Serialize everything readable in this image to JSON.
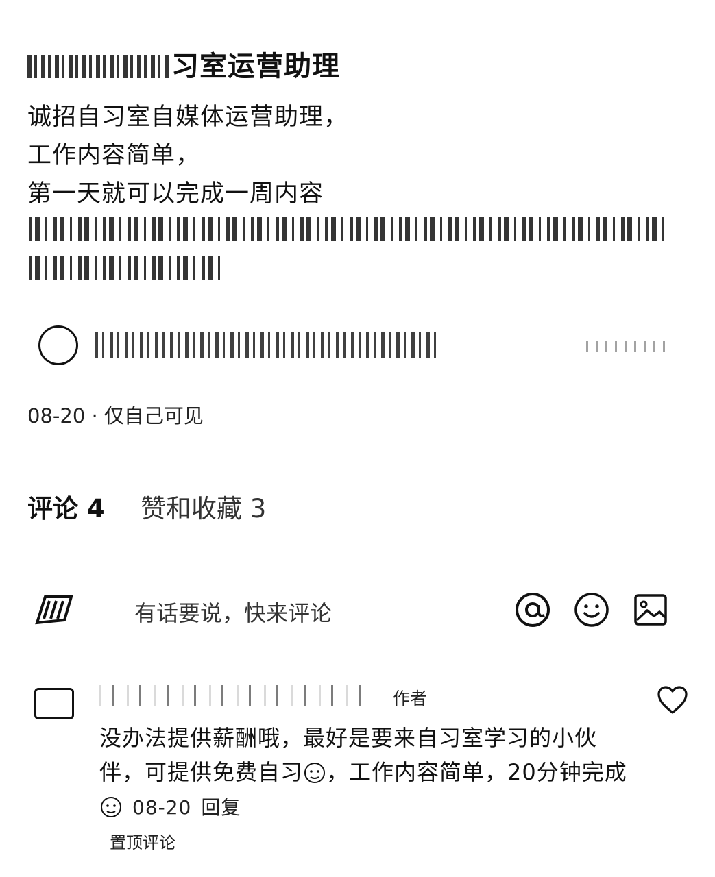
{
  "post": {
    "title_suffix": "习室运营助理",
    "lines": [
      "诚招自习室自媒体运营助理，",
      "工作内容简单，",
      "第一天就可以完成一周内容"
    ],
    "meta": "08-20 · 仅自己可见"
  },
  "tabs": {
    "comments": "评论 4",
    "likes": "赞和收藏 3"
  },
  "composer": {
    "placeholder": "有话要说，快来评论",
    "icons": [
      "at-icon",
      "smile-icon",
      "image-icon"
    ]
  },
  "comment": {
    "badge": "作者",
    "text_part1": "没办法提供薪酬哦，最好是要来自习室学习的小伙伴，可提供免费自习",
    "text_part2": "，工作内容简单，20分钟完成",
    "time": "08-20",
    "reply": "回复",
    "pinned": "置顶评论"
  }
}
